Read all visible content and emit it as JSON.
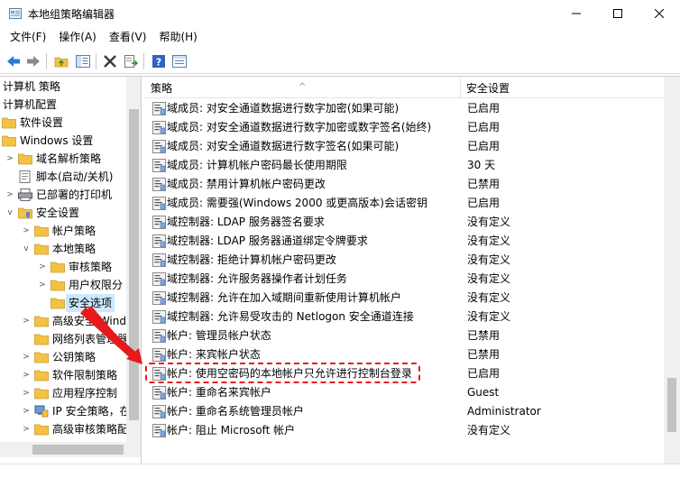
{
  "window": {
    "title": "本地组策略编辑器"
  },
  "menu": [
    "文件(F)",
    "操作(A)",
    "查看(V)",
    "帮助(H)"
  ],
  "tree": [
    {
      "label": "计算机 策略",
      "indent": 0,
      "icon": "none",
      "expander": ""
    },
    {
      "label": "计算机配置",
      "indent": 0,
      "icon": "none",
      "expander": ""
    },
    {
      "label": "软件设置",
      "indent": 1,
      "icon": "folder",
      "expander": ""
    },
    {
      "label": "Windows 设置",
      "indent": 1,
      "icon": "folder",
      "expander": ""
    },
    {
      "label": "域名解析策略",
      "indent": 2,
      "icon": "folder",
      "expander": ">"
    },
    {
      "label": "脚本(启动/关机)",
      "indent": 2,
      "icon": "script",
      "expander": ""
    },
    {
      "label": "已部署的打印机",
      "indent": 2,
      "icon": "printer",
      "expander": ">"
    },
    {
      "label": "安全设置",
      "indent": 2,
      "icon": "shield",
      "expander": "v"
    },
    {
      "label": "帐户策略",
      "indent": 3,
      "icon": "folder",
      "expander": ">"
    },
    {
      "label": "本地策略",
      "indent": 3,
      "icon": "folder",
      "expander": "v"
    },
    {
      "label": "审核策略",
      "indent": 4,
      "icon": "folder",
      "expander": ">"
    },
    {
      "label": "用户权限分",
      "indent": 4,
      "icon": "folder",
      "expander": ">"
    },
    {
      "label": "安全选项",
      "indent": 4,
      "icon": "folder",
      "expander": "",
      "selected": true
    },
    {
      "label": "高级安全 Wind",
      "indent": 3,
      "icon": "folder",
      "expander": ">"
    },
    {
      "label": "网络列表管理器",
      "indent": 3,
      "icon": "folder",
      "expander": ""
    },
    {
      "label": "公钥策略",
      "indent": 3,
      "icon": "folder",
      "expander": ">"
    },
    {
      "label": "软件限制策略",
      "indent": 3,
      "icon": "folder",
      "expander": ">"
    },
    {
      "label": "应用程序控制",
      "indent": 3,
      "icon": "folder",
      "expander": ">"
    },
    {
      "label": "IP 安全策略，在",
      "indent": 3,
      "icon": "ipsec",
      "expander": ">"
    },
    {
      "label": "高级审核策略配",
      "indent": 3,
      "icon": "folder",
      "expander": ">"
    }
  ],
  "list": {
    "headers": {
      "policy": "策略",
      "setting": "安全设置"
    },
    "rows": [
      {
        "policy": "域成员: 对安全通道数据进行数字加密(如果可能)",
        "setting": "已启用"
      },
      {
        "policy": "域成员: 对安全通道数据进行数字加密或数字签名(始终)",
        "setting": "已启用"
      },
      {
        "policy": "域成员: 对安全通道数据进行数字签名(如果可能)",
        "setting": "已启用"
      },
      {
        "policy": "域成员: 计算机帐户密码最长使用期限",
        "setting": "30 天"
      },
      {
        "policy": "域成员: 禁用计算机帐户密码更改",
        "setting": "已禁用"
      },
      {
        "policy": "域成员: 需要强(Windows 2000 或更高版本)会话密钥",
        "setting": "已启用"
      },
      {
        "policy": "域控制器: LDAP 服务器签名要求",
        "setting": "没有定义"
      },
      {
        "policy": "域控制器: LDAP 服务器通道绑定令牌要求",
        "setting": "没有定义"
      },
      {
        "policy": "域控制器: 拒绝计算机帐户密码更改",
        "setting": "没有定义"
      },
      {
        "policy": "域控制器: 允许服务器操作者计划任务",
        "setting": "没有定义"
      },
      {
        "policy": "域控制器:  允许在加入域期间重新使用计算机帐户",
        "setting": "没有定义"
      },
      {
        "policy": "域控制器:  允许易受攻击的 Netlogon 安全通道连接",
        "setting": "没有定义"
      },
      {
        "policy": "帐户: 管理员帐户状态",
        "setting": "已禁用"
      },
      {
        "policy": "帐户: 来宾帐户状态",
        "setting": "已禁用"
      },
      {
        "policy": "帐户: 使用空密码的本地帐户只允许进行控制台登录",
        "setting": "已启用",
        "highlighted": true
      },
      {
        "policy": "帐户: 重命名来宾帐户",
        "setting": "Guest"
      },
      {
        "policy": "帐户: 重命名系统管理员帐户",
        "setting": "Administrator"
      },
      {
        "policy": "帐户: 阻止 Microsoft 帐户",
        "setting": "没有定义"
      }
    ]
  },
  "colors": {
    "highlight": "#e8191d",
    "selection": "#cce8ff",
    "folder": "#f4c243"
  }
}
